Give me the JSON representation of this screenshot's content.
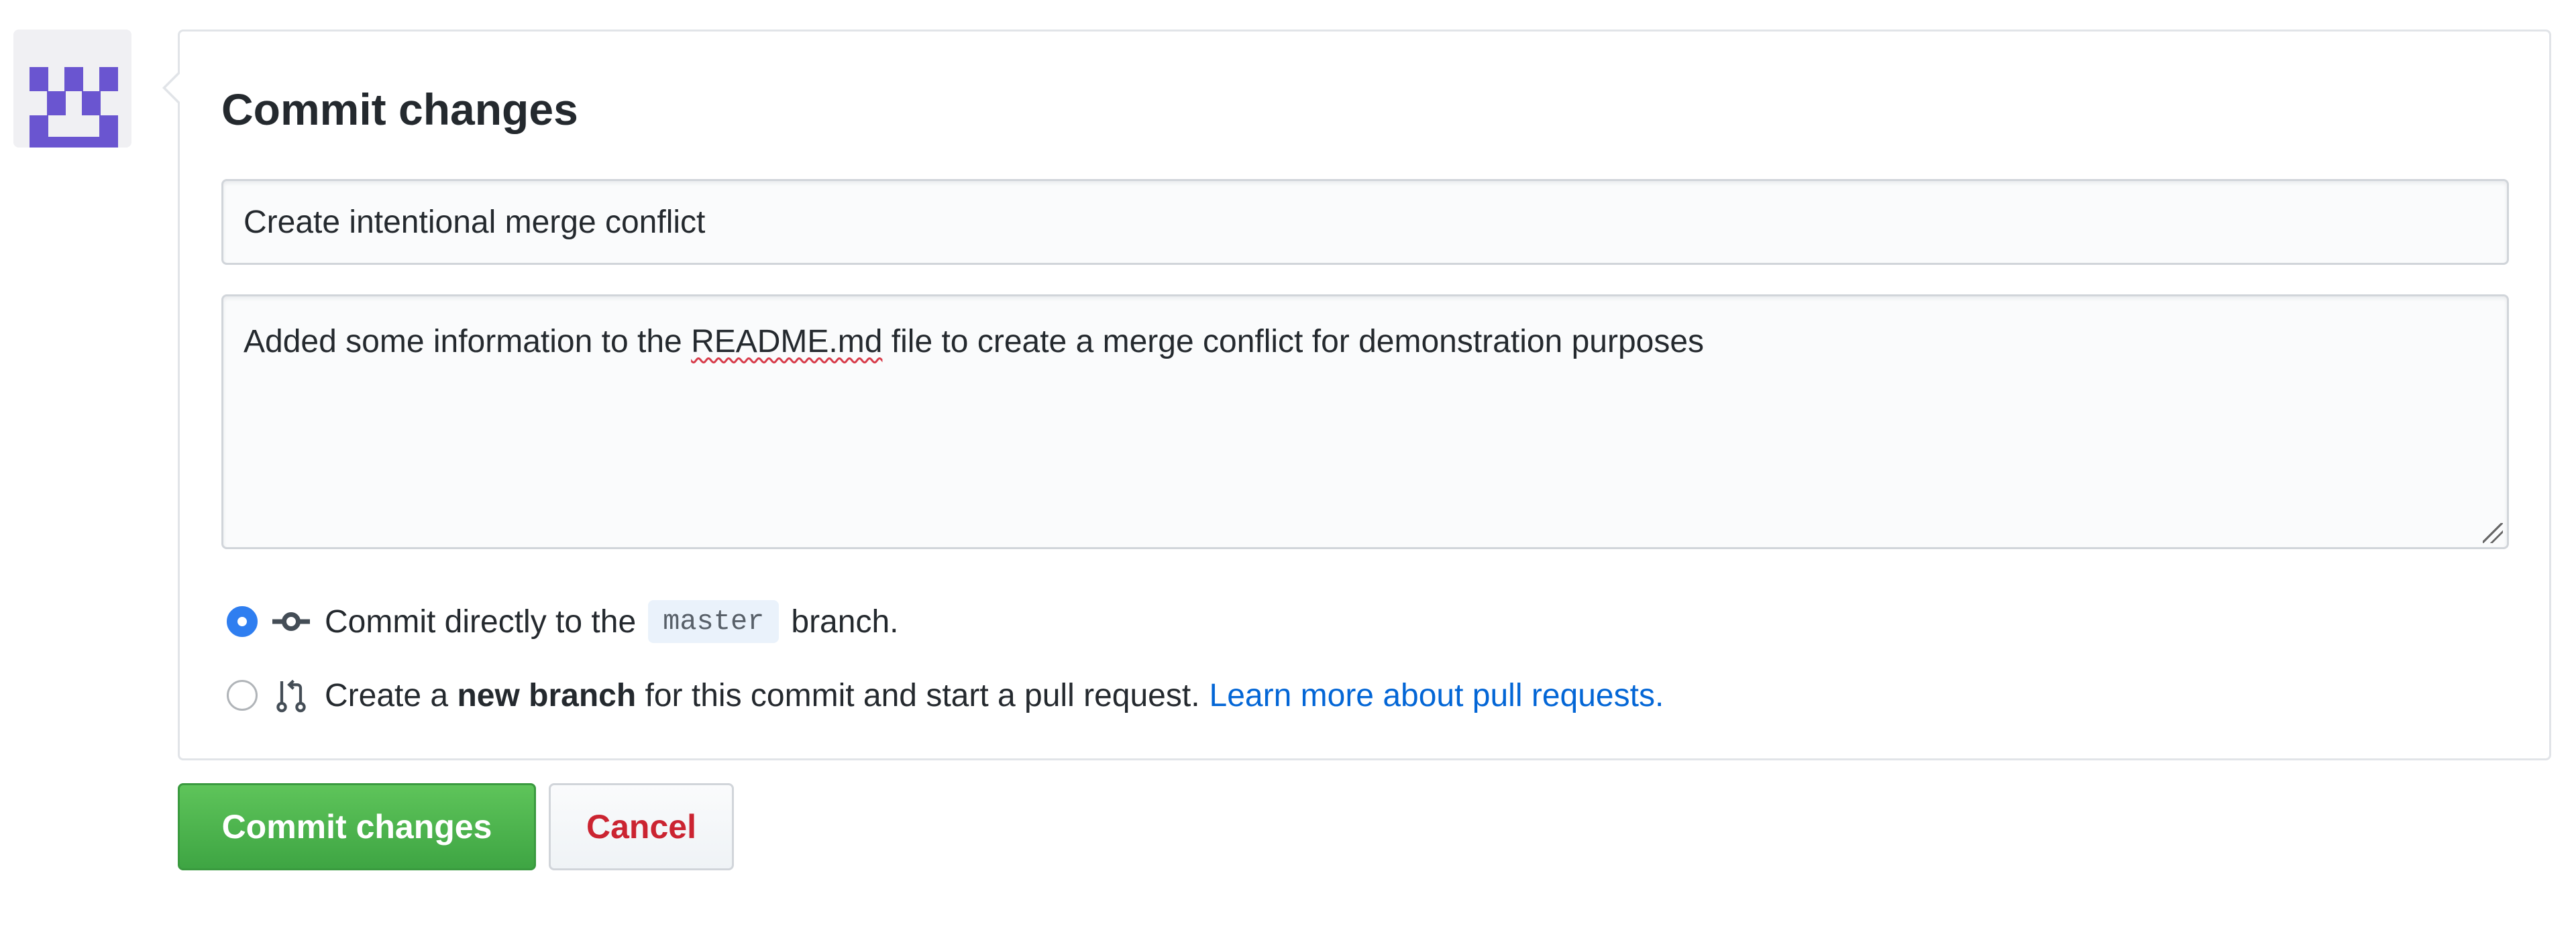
{
  "avatar": {
    "icon": "identicon-avatar",
    "color": "#6a55d0"
  },
  "form": {
    "title": "Commit changes",
    "summary_value": "Create intentional merge conflict",
    "description_prefix": "Added some information to the ",
    "description_spellchecked_word": "README.md",
    "description_suffix": " file to create a merge conflict for demonstration purposes"
  },
  "options": {
    "direct": {
      "selected": true,
      "icon": "git-commit-icon",
      "text_before": "Commit directly to the",
      "branch": "master",
      "text_after": "branch."
    },
    "new_branch": {
      "selected": false,
      "icon": "git-pull-request-icon",
      "text_before": "Create a",
      "bold": "new branch",
      "text_after": "for this commit and start a pull request.",
      "link": "Learn more about pull requests."
    }
  },
  "buttons": {
    "commit_label": "Commit changes",
    "cancel_label": "Cancel"
  },
  "colors": {
    "primary_green": "#3ea543",
    "cancel_red": "#cb2431",
    "link_blue": "#0366d6",
    "radio_blue": "#2f7ef0"
  }
}
